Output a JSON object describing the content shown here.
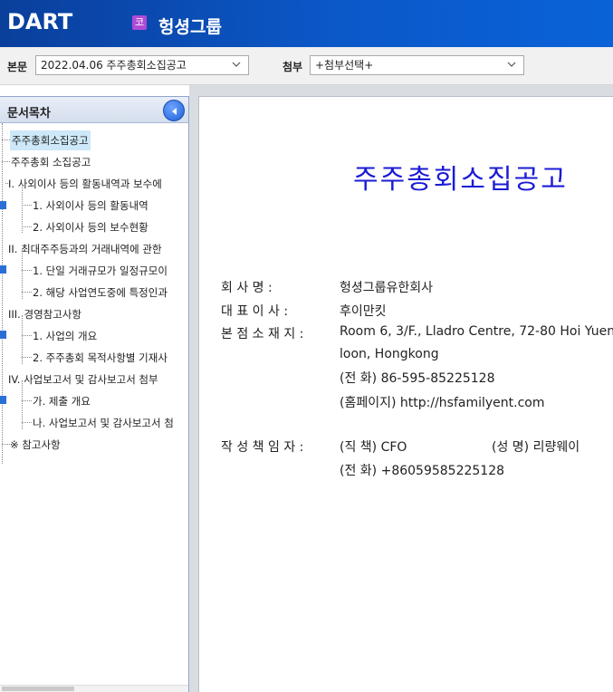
{
  "header": {
    "logo_text": "DART",
    "company_badge": "코",
    "company_name": "헝셩그룹"
  },
  "toolbar": {
    "main_label": "본문",
    "main_select": "2022.04.06  주주총회소집공고",
    "attach_label": "첨부",
    "attach_select": "+첨부선택+"
  },
  "toc": {
    "title": "문서목차",
    "items": [
      {
        "label": "주주총회소집공고",
        "level": 0,
        "selected": true
      },
      {
        "label": "주주총회 소집공고",
        "level": 0
      },
      {
        "label": "I. 사외이사 등의 활동내역과 보수에",
        "level": 0,
        "expandable": true
      },
      {
        "label": "1. 사외이사 등의 활동내역",
        "level": 1
      },
      {
        "label": "2. 사외이사 등의 보수현황",
        "level": 1
      },
      {
        "label": "II. 최대주주등과의 거래내역에 관한",
        "level": 0,
        "expandable": true
      },
      {
        "label": "1. 단일 거래규모가 일정규모이",
        "level": 1
      },
      {
        "label": "2. 해당 사업연도중에 특정인과",
        "level": 1
      },
      {
        "label": "III. 경영참고사항",
        "level": 0,
        "expandable": true
      },
      {
        "label": "1. 사업의 개요",
        "level": 1
      },
      {
        "label": "2. 주주총회 목적사항별 기재사",
        "level": 1
      },
      {
        "label": "IV. 사업보고서 및 감사보고서 첨부",
        "level": 0,
        "expandable": true
      },
      {
        "label": "가. 제출 개요",
        "level": 1
      },
      {
        "label": "나. 사업보고서 및 감사보고서 첨",
        "level": 1
      },
      {
        "label": "※ 참고사항",
        "level": 0
      }
    ]
  },
  "document": {
    "title": "주주총회소집공고",
    "company_label": "회   사   명 :",
    "company_value": "헝셩그룹유한회사",
    "ceo_label": "대 표 이 사 :",
    "ceo_value": "후이만킷",
    "hq_label": "본 점 소 재 지 :",
    "hq_line1": "Room 6, 3/F., Lladro Centre, 72-80 Hoi Yuen",
    "hq_line2": "loon, Hongkong",
    "hq_phone": "(전    화) 86-595-85225128",
    "hq_homepage": "(홈페이지) http://hsfamilyent.com",
    "author_label": "작 성 책 임 자 :",
    "author_title": "(직  책) CFO",
    "author_name": "(성  명) 리량웨이",
    "author_phone": "(전  화) +86059585225128"
  }
}
